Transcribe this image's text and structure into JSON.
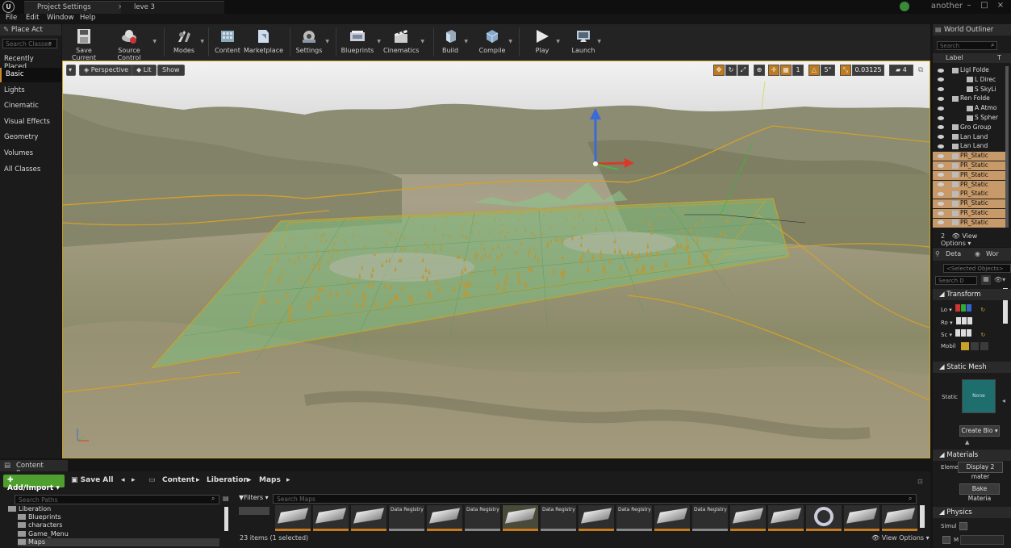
{
  "title_bar": {
    "tabs": [
      {
        "label": "Project Settings"
      },
      {
        "label": "leve 3"
      }
    ],
    "user": "another"
  },
  "menu": [
    "File",
    "Edit",
    "Window",
    "Help"
  ],
  "place_actors": {
    "tab_label": "Place Act",
    "search_placeholder": "Search Classes",
    "categories": [
      "Recently Placed",
      "Basic",
      "Lights",
      "Cinematic",
      "Visual Effects",
      "Geometry",
      "Volumes",
      "All Classes"
    ],
    "active": "Basic"
  },
  "toolbar": {
    "buttons": [
      {
        "label": "Save Current",
        "icon": "save-icon"
      },
      {
        "label": "Source Control",
        "icon": "source-control-icon"
      },
      {
        "label": "Modes",
        "icon": "modes-icon"
      },
      {
        "label": "Content",
        "icon": "content-icon"
      },
      {
        "label": "Marketplace",
        "icon": "marketplace-icon"
      },
      {
        "label": "Settings",
        "icon": "settings-icon"
      },
      {
        "label": "Blueprints",
        "icon": "blueprints-icon"
      },
      {
        "label": "Cinematics",
        "icon": "cinematics-icon"
      },
      {
        "label": "Build",
        "icon": "build-icon"
      },
      {
        "label": "Compile",
        "icon": "compile-icon"
      },
      {
        "label": "Play",
        "icon": "play-icon"
      },
      {
        "label": "Launch",
        "icon": "launch-icon"
      }
    ]
  },
  "viewport": {
    "perspective": "Perspective",
    "lit": "Lit",
    "show": "Show",
    "grid_snap": "1",
    "rot_snap": "5°",
    "scale_snap": "0.03125",
    "camera_speed": "4"
  },
  "world_outliner": {
    "tab_label": "World Outliner",
    "search_placeholder": "Search",
    "col_label": "Label",
    "col_type": "T",
    "rows": [
      {
        "label": "LigI Folde",
        "sel": false
      },
      {
        "label": "L Direc",
        "sel": false
      },
      {
        "label": "S SkyLi",
        "sel": false
      },
      {
        "label": "Ren Folde",
        "sel": false
      },
      {
        "label": "A Atmo",
        "sel": false
      },
      {
        "label": "S Spher",
        "sel": false
      },
      {
        "label": "Gro Group",
        "sel": false
      },
      {
        "label": "Lan Land",
        "sel": false
      },
      {
        "label": "Lan Land",
        "sel": false
      },
      {
        "label": "PR_Static",
        "sel": true
      },
      {
        "label": "PR_Static",
        "sel": true
      },
      {
        "label": "PR_Static",
        "sel": true
      },
      {
        "label": "PR_Static",
        "sel": true
      },
      {
        "label": "PR_Static",
        "sel": true
      },
      {
        "label": "PR_Static",
        "sel": true
      },
      {
        "label": "PR_Static",
        "sel": true
      },
      {
        "label": "PR_Static",
        "sel": true
      }
    ],
    "count": "2",
    "view_options": "View Options"
  },
  "details": {
    "tab_details": "Deta",
    "tab_world": "Wor",
    "selected_objects": "<Selected Objects>",
    "search_placeholder": "Search D",
    "transform": "Transform",
    "location": "Lo",
    "rotation": "Ro",
    "scale": "Sc",
    "mobility": "Mobil",
    "static_mesh_section": "Static Mesh",
    "static_mesh_label": "Static",
    "mesh_thumb": "None",
    "create_blueprint": "Create Blo",
    "materials_section": "Materials",
    "element": "Eleme",
    "display_materials": "Display 2 mater",
    "bake_materials": "Bake Materia",
    "physics_section": "Physics",
    "simulate": "Simul",
    "mass": "M"
  },
  "content_browser": {
    "tab_label": "Content Browser",
    "add_import": "Add/Import",
    "save_all": "Save All",
    "breadcrumb": [
      "Content",
      "Liberation",
      "Maps"
    ],
    "search_paths_placeholder": "Search Paths",
    "filters": "Filters",
    "search_maps_placeholder": "Search Maps",
    "tree": [
      {
        "label": "Liberation",
        "indent": 0
      },
      {
        "label": "Blueprints",
        "indent": 1
      },
      {
        "label": "characters",
        "indent": 1
      },
      {
        "label": "Game_Menu",
        "indent": 1
      },
      {
        "label": "Maps",
        "indent": 1
      }
    ],
    "data_registry_label": "Data Registry",
    "status": "23 items (1 selected)",
    "view_options": "View Options"
  }
}
